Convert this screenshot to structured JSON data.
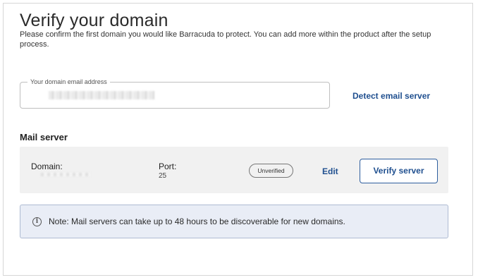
{
  "page": {
    "title": "Verify your domain",
    "subtitle": "Please confirm the first domain you would like Barracuda to protect. You can add more within the product after the setup process."
  },
  "email_field": {
    "label": "Your domain email address",
    "value": ""
  },
  "detect_link": "Detect email server",
  "mail_server": {
    "section_title": "Mail server",
    "domain_label": "Domain:",
    "domain_value": "",
    "port_label": "Port:",
    "port_value": "25",
    "status": "Unverified",
    "edit_label": "Edit",
    "verify_label": "Verify server"
  },
  "note": {
    "icon": "info-icon",
    "text": "Note: Mail servers can take up to 48 hours to be discoverable for new domains."
  }
}
